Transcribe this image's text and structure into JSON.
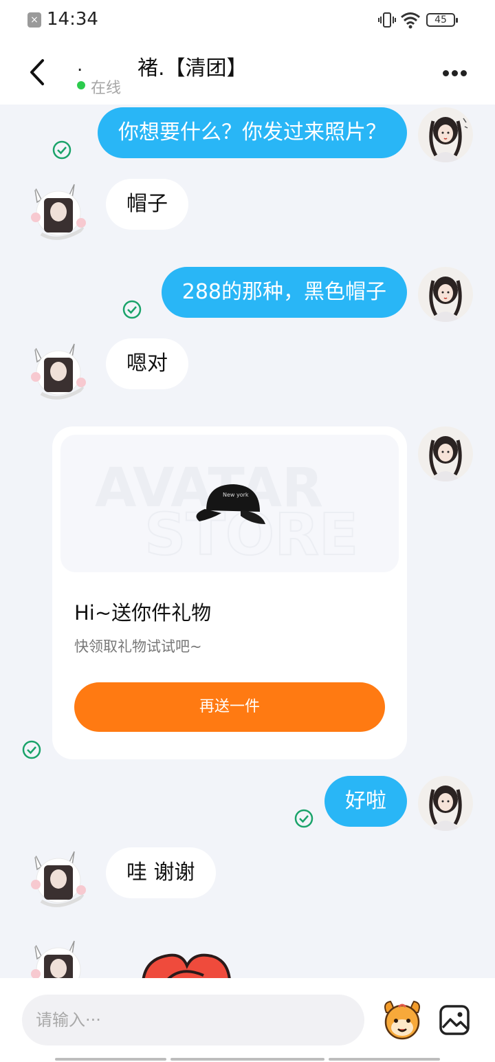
{
  "status_bar": {
    "time": "14:34",
    "battery": "45",
    "notification_icon": "x-notification-icon"
  },
  "header": {
    "name_prefix": ".",
    "name": "褚.【清团】",
    "status": "在线",
    "status_color": "#2ccb4d"
  },
  "messages": [
    {
      "side": "me",
      "text": "你想要什么？你发过来照片？",
      "delivered": true
    },
    {
      "side": "them",
      "text": "帽子"
    },
    {
      "side": "me",
      "text": "288的那种，黑色帽子",
      "delivered": true
    },
    {
      "side": "them",
      "text": "嗯对"
    },
    {
      "side": "me",
      "type": "gift_card",
      "delivered": true
    },
    {
      "side": "me",
      "text": "好啦",
      "delivered": true
    },
    {
      "side": "them",
      "text": "哇  谢谢"
    },
    {
      "side": "them",
      "type": "sticker"
    }
  ],
  "gift_card": {
    "watermark_line1": "AVATAR",
    "watermark_line2": "STORE",
    "cap_text": "New york",
    "title": "Hi~送你件礼物",
    "subtitle": "快领取礼物试试吧~",
    "button_label": "再送一件",
    "button_color": "#ff7a12"
  },
  "input": {
    "placeholder": "请输入···"
  },
  "colors": {
    "my_bubble": "#29b6f6",
    "their_bubble": "#ffffff",
    "check": "#1aa36a",
    "background": "#f2f4f9"
  }
}
